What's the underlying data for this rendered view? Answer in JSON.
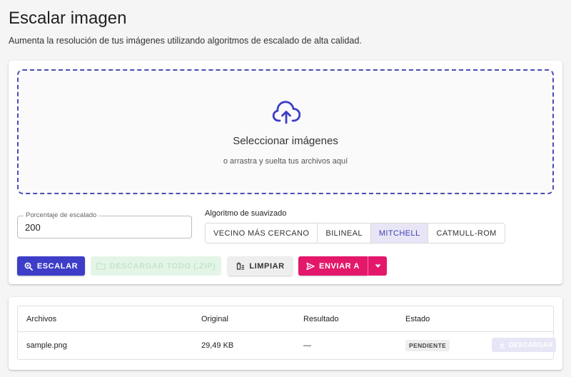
{
  "header": {
    "title": "Escalar imagen",
    "subtitle": "Aumenta la resolución de tus imágenes utilizando algoritmos de escalado de alta calidad."
  },
  "dropzone": {
    "title": "Seleccionar imágenes",
    "subtitle": "o arrastra y suelta tus archivos aquí",
    "icon": "cloud-upload-icon"
  },
  "scale_field": {
    "label": "Porcentaje de escalado",
    "value": "200"
  },
  "algorithm": {
    "label": "Algoritmo de suavizado",
    "options": [
      "VECINO MÁS CERCANO",
      "BILINEAL",
      "MITCHELL",
      "CATMULL-ROM"
    ],
    "selected": "MITCHELL"
  },
  "actions": {
    "scale": "ESCALAR",
    "download_all": "DESCARGAR TODO (.ZIP)",
    "clear": "LIMPIAR",
    "send_to": "ENVIAR A"
  },
  "table": {
    "columns": [
      "Archivos",
      "Original",
      "Resultado",
      "Estado"
    ],
    "rows": [
      {
        "file": "sample.png",
        "original": "29,49 KB",
        "result": "—",
        "status": "PENDIENTE",
        "action": "DESCARGAR"
      }
    ]
  },
  "colors": {
    "primary": "#3d3dc8",
    "accent": "#e3186b",
    "selected_bg": "#e8e6f6",
    "dropzone_border": "#4a4db5"
  }
}
